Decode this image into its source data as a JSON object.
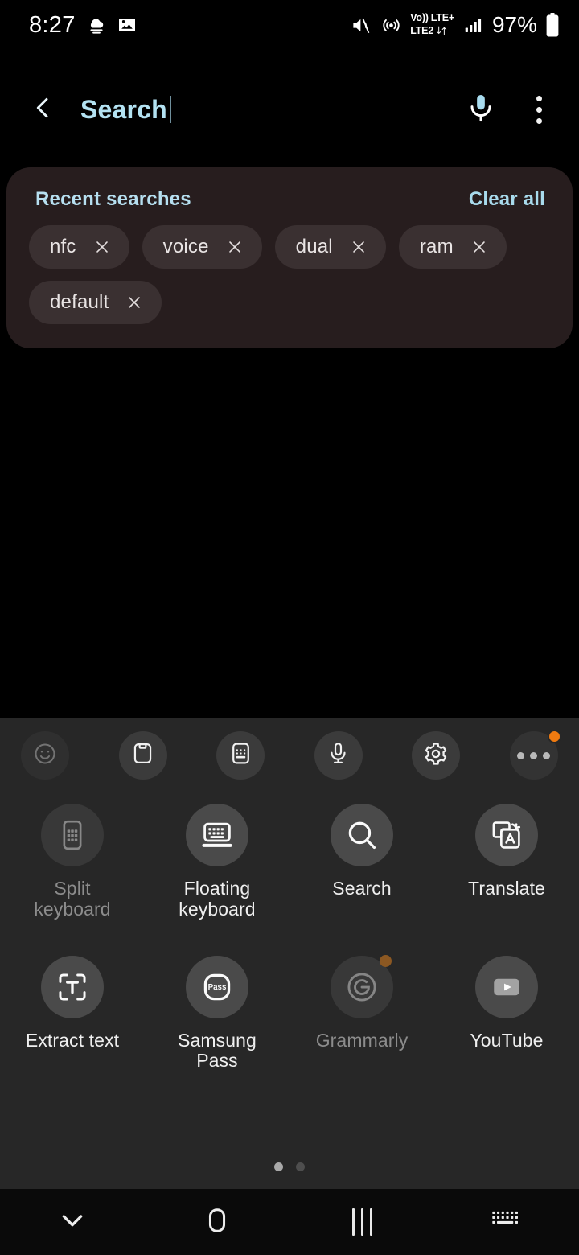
{
  "status_bar": {
    "time": "8:27",
    "left_icons": [
      "weather-cloud-icon",
      "gallery-image-icon"
    ],
    "mute_icon": "sound-muted-icon",
    "hotspot_icon": "hotspot-icon",
    "volte_label": "Vo))",
    "network_label": "LTE2",
    "lte_plus_label": "LTE+",
    "data_arrows_icon": "data-transfer-icon",
    "signal_icon": "signal-bars-icon",
    "battery_percent": "97%",
    "battery_icon": "battery-full-icon"
  },
  "app_bar": {
    "back_icon": "back-chevron-icon",
    "title": "Search",
    "mic_icon": "microphone-icon",
    "overflow_icon": "more-options-icon",
    "title_color": "#b3e2f2"
  },
  "recent_searches": {
    "title": "Recent searches",
    "clear_all_label": "Clear all",
    "accent_color": "#a8daec",
    "card_bg": "#271d1e",
    "chip_bg": "#3a3031",
    "chips": [
      {
        "label": "nfc",
        "remove_icon": "close-icon"
      },
      {
        "label": "voice",
        "remove_icon": "close-icon"
      },
      {
        "label": "dual",
        "remove_icon": "close-icon"
      },
      {
        "label": "ram",
        "remove_icon": "close-icon"
      },
      {
        "label": "default",
        "remove_icon": "close-icon"
      }
    ]
  },
  "keyboard_panel": {
    "bg": "#272727",
    "toolbar": [
      {
        "name": "emoji-button",
        "icon": "emoji-smiley-icon",
        "dim": true,
        "badge": false
      },
      {
        "name": "clipboard-button",
        "icon": "clipboard-icon",
        "dim": false,
        "badge": false
      },
      {
        "name": "keyboard-modes-button",
        "icon": "keyboard-layout-icon",
        "dim": false,
        "badge": false
      },
      {
        "name": "voice-input-button",
        "icon": "microphone-icon",
        "dim": false,
        "badge": false
      },
      {
        "name": "keyboard-settings-button",
        "icon": "gear-icon",
        "dim": false,
        "badge": false
      },
      {
        "name": "more-toolbar-button",
        "icon": "more-horizontal-icon",
        "dim": false,
        "badge": true
      }
    ],
    "badge_color": "#ef7a10",
    "apps": [
      [
        {
          "label": "Split\nkeyboard",
          "icon": "split-keyboard-icon",
          "dim": true,
          "badge": false
        },
        {
          "label": "Floating\nkeyboard",
          "icon": "floating-keyboard-icon",
          "dim": false,
          "badge": false
        },
        {
          "label": "Search",
          "icon": "search-icon",
          "dim": false,
          "badge": false
        },
        {
          "label": "Translate",
          "icon": "translate-icon",
          "dim": false,
          "badge": false
        }
      ],
      [
        {
          "label": "Extract text",
          "icon": "extract-text-icon",
          "dim": false,
          "badge": false
        },
        {
          "label": "Samsung\nPass",
          "icon": "samsung-pass-icon",
          "dim": false,
          "badge": false
        },
        {
          "label": "Grammarly",
          "icon": "grammarly-icon",
          "dim": true,
          "badge": true
        },
        {
          "label": "YouTube",
          "icon": "youtube-icon",
          "dim": false,
          "badge": false
        }
      ]
    ],
    "pagination": {
      "total": 2,
      "current": 1
    }
  },
  "nav_bar": {
    "items": [
      {
        "name": "hide-keyboard-button",
        "icon": "chevron-down-icon"
      },
      {
        "name": "home-button",
        "icon": "home-icon"
      },
      {
        "name": "recents-button",
        "icon": "recents-icon"
      },
      {
        "name": "keyboard-switch-button",
        "icon": "keyboard-switch-icon"
      }
    ]
  }
}
